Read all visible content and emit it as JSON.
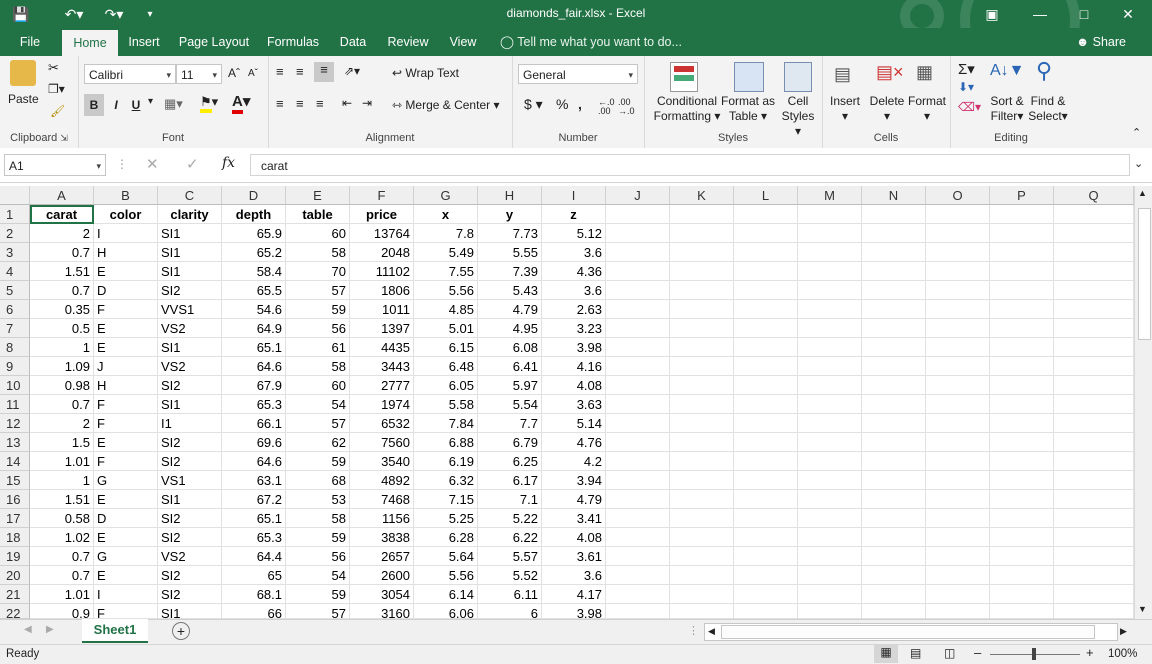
{
  "app": {
    "title": "diamonds_fair.xlsx - Excel",
    "tabs": [
      "File",
      "Home",
      "Insert",
      "Page Layout",
      "Formulas",
      "Data",
      "Review",
      "View"
    ],
    "active_tab": "Home",
    "tell_me": "Tell me what you want to do...",
    "share": "Share"
  },
  "ribbon": {
    "clipboard": {
      "paste": "Paste",
      "label": "Clipboard"
    },
    "font": {
      "name": "Calibri",
      "size": "11",
      "label": "Font",
      "bold": "B",
      "italic": "I",
      "underline": "U"
    },
    "alignment": {
      "wrap": "Wrap Text",
      "merge": "Merge & Center",
      "label": "Alignment"
    },
    "number": {
      "format": "General",
      "currency": "$",
      "percent": "%",
      "comma": ",",
      "label": "Number"
    },
    "styles": {
      "conditional": "Conditional",
      "conditional2": "Formatting",
      "format_as": "Format as",
      "format_as2": "Table",
      "cell": "Cell",
      "cell2": "Styles",
      "label": "Styles"
    },
    "cells": {
      "insert": "Insert",
      "delete": "Delete",
      "format": "Format",
      "label": "Cells"
    },
    "editing": {
      "sum": "Σ",
      "sort": "Sort &",
      "sort2": "Filter",
      "find": "Find &",
      "find2": "Select",
      "label": "Editing"
    }
  },
  "formula_bar": {
    "name_box": "A1",
    "fx": "fx",
    "content": "carat"
  },
  "columns": [
    "A",
    "B",
    "C",
    "D",
    "E",
    "F",
    "G",
    "H",
    "I",
    "J",
    "K",
    "L",
    "M",
    "N",
    "O",
    "P",
    "Q"
  ],
  "rows": [
    [
      "carat",
      "color",
      "clarity",
      "depth",
      "table",
      "price",
      "x",
      "y",
      "z"
    ],
    [
      "2",
      "I",
      "SI1",
      "65.9",
      "60",
      "13764",
      "7.8",
      "7.73",
      "5.12"
    ],
    [
      "0.7",
      "H",
      "SI1",
      "65.2",
      "58",
      "2048",
      "5.49",
      "5.55",
      "3.6"
    ],
    [
      "1.51",
      "E",
      "SI1",
      "58.4",
      "70",
      "11102",
      "7.55",
      "7.39",
      "4.36"
    ],
    [
      "0.7",
      "D",
      "SI2",
      "65.5",
      "57",
      "1806",
      "5.56",
      "5.43",
      "3.6"
    ],
    [
      "0.35",
      "F",
      "VVS1",
      "54.6",
      "59",
      "1011",
      "4.85",
      "4.79",
      "2.63"
    ],
    [
      "0.5",
      "E",
      "VS2",
      "64.9",
      "56",
      "1397",
      "5.01",
      "4.95",
      "3.23"
    ],
    [
      "1",
      "E",
      "SI1",
      "65.1",
      "61",
      "4435",
      "6.15",
      "6.08",
      "3.98"
    ],
    [
      "1.09",
      "J",
      "VS2",
      "64.6",
      "58",
      "3443",
      "6.48",
      "6.41",
      "4.16"
    ],
    [
      "0.98",
      "H",
      "SI2",
      "67.9",
      "60",
      "2777",
      "6.05",
      "5.97",
      "4.08"
    ],
    [
      "0.7",
      "F",
      "SI1",
      "65.3",
      "54",
      "1974",
      "5.58",
      "5.54",
      "3.63"
    ],
    [
      "2",
      "F",
      "I1",
      "66.1",
      "57",
      "6532",
      "7.84",
      "7.7",
      "5.14"
    ],
    [
      "1.5",
      "E",
      "SI2",
      "69.6",
      "62",
      "7560",
      "6.88",
      "6.79",
      "4.76"
    ],
    [
      "1.01",
      "F",
      "SI2",
      "64.6",
      "59",
      "3540",
      "6.19",
      "6.25",
      "4.2"
    ],
    [
      "1",
      "G",
      "VS1",
      "63.1",
      "68",
      "4892",
      "6.32",
      "6.17",
      "3.94"
    ],
    [
      "1.51",
      "E",
      "SI1",
      "67.2",
      "53",
      "7468",
      "7.15",
      "7.1",
      "4.79"
    ],
    [
      "0.58",
      "D",
      "SI2",
      "65.1",
      "58",
      "1156",
      "5.25",
      "5.22",
      "3.41"
    ],
    [
      "1.02",
      "E",
      "SI2",
      "65.3",
      "59",
      "3838",
      "6.28",
      "6.22",
      "4.08"
    ],
    [
      "0.7",
      "G",
      "VS2",
      "64.4",
      "56",
      "2657",
      "5.64",
      "5.57",
      "3.61"
    ],
    [
      "0.7",
      "E",
      "SI2",
      "65",
      "54",
      "2600",
      "5.56",
      "5.52",
      "3.6"
    ],
    [
      "1.01",
      "I",
      "SI2",
      "68.1",
      "59",
      "3054",
      "6.14",
      "6.11",
      "4.17"
    ],
    [
      "0.9",
      "F",
      "SI1",
      "66",
      "57",
      "3160",
      "6.06",
      "6",
      "3.98"
    ]
  ],
  "sheet": {
    "name": "Sheet1"
  },
  "status": {
    "ready": "Ready",
    "zoom": "100%"
  }
}
